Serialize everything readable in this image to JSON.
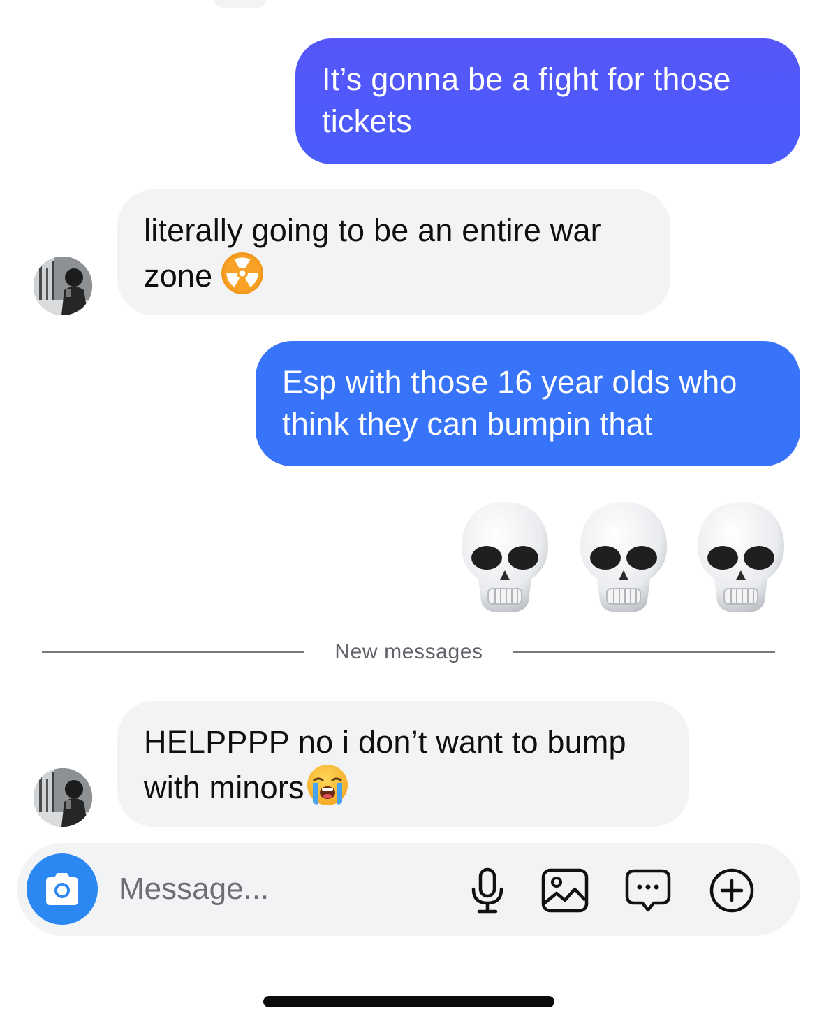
{
  "thread": {
    "messages": [
      {
        "direction": "outgoing",
        "text": "It’s gonna be a fight for those tickets"
      },
      {
        "direction": "incoming",
        "text": "literally going to be an entire war zone",
        "emoji": "radioactive-emoji"
      },
      {
        "direction": "outgoing",
        "text": "Esp with those 16 year olds who think they can bumpin that"
      },
      {
        "direction": "outgoing",
        "type": "emoji-only",
        "emoji": [
          "skull-emoji",
          "skull-emoji",
          "skull-emoji"
        ]
      },
      {
        "direction": "incoming",
        "text": "HELPPPP no i don’t want to bump with minors",
        "emoji": "loudly-crying-emoji"
      }
    ],
    "divider_label": "New messages"
  },
  "composer": {
    "placeholder": "Message...",
    "icons": [
      "camera-icon",
      "microphone-icon",
      "gallery-icon",
      "sticker-icon",
      "plus-icon"
    ],
    "camera_button_color": "#2b88f3"
  },
  "colors": {
    "outgoing_primary": "#4a5cfb",
    "outgoing_secondary": "#3774f9",
    "incoming_bubble": "#f2f3f5"
  }
}
